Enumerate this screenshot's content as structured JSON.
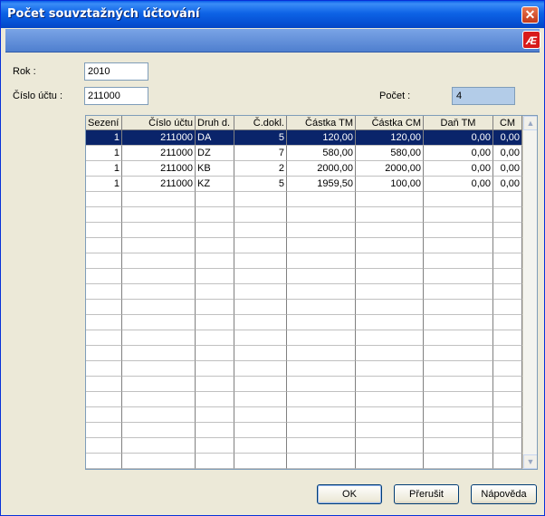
{
  "window": {
    "title": "Počet souvztažných účtování",
    "close_glyph": "✕"
  },
  "toolbar": {
    "logo_text": "Æ",
    "logo_icon": "app-logo-icon"
  },
  "form": {
    "year_label": "Rok :",
    "year_value": "2010",
    "account_label": "Číslo účtu :",
    "account_value": "211000",
    "count_label": "Počet :",
    "count_value": "4"
  },
  "table": {
    "columns": [
      "Sezení",
      "Číslo účtu",
      "Druh d.",
      "Č.dokl.",
      "Částka TM",
      "Částka CM",
      "Daň TM",
      "CM"
    ],
    "rows": [
      [
        "1",
        "211000",
        "DA",
        "5",
        "120,00",
        "120,00",
        "0,00",
        "0,00"
      ],
      [
        "1",
        "211000",
        "DZ",
        "7",
        "580,00",
        "580,00",
        "0,00",
        "0,00"
      ],
      [
        "1",
        "211000",
        "KB",
        "2",
        "2000,00",
        "2000,00",
        "0,00",
        "0,00"
      ],
      [
        "1",
        "211000",
        "KZ",
        "5",
        "1959,50",
        "100,00",
        "0,00",
        "0,00"
      ]
    ],
    "selected_row": 0,
    "scroll_up": "▲",
    "scroll_down": "▼"
  },
  "buttons": {
    "ok": "OK",
    "cancel": "Přerušit",
    "help": "Nápověda"
  },
  "colors": {
    "title_bar": "#0a5fe8",
    "selection": "#0a246a",
    "count_box": "#b3cce8"
  }
}
